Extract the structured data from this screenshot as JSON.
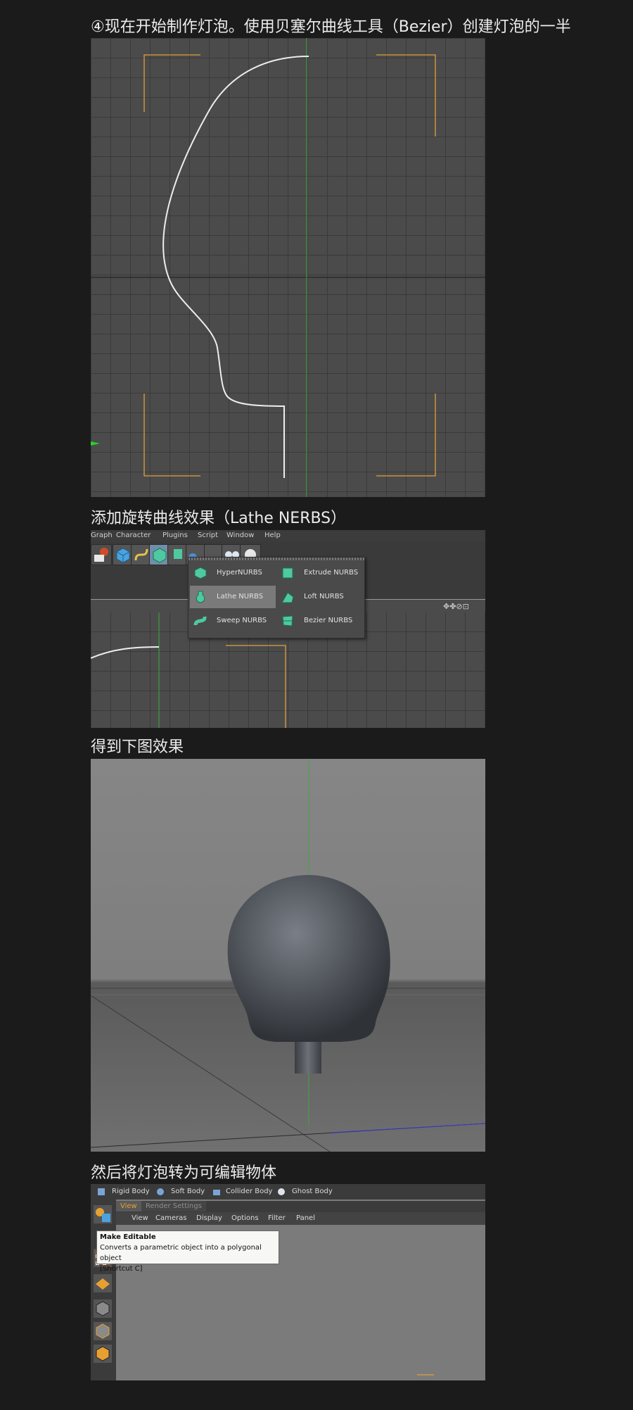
{
  "captions": {
    "step4": "④现在开始制作灯泡。使用贝塞尔曲线工具（Bezier）创建灯泡的一半",
    "lathe": "添加旋转曲线效果（Lathe NERBS）",
    "result": "得到下图效果",
    "editable": "然后将灯泡转为可编辑物体"
  },
  "menu": {
    "items": [
      "Graph",
      "Character",
      "Plugins",
      "Script",
      "Window",
      "Help"
    ]
  },
  "nurbs_menu": {
    "items": [
      {
        "label": "HyperNURBS",
        "icon": "hypernurbs-icon"
      },
      {
        "label": "Extrude NURBS",
        "icon": "extrude-nurbs-icon"
      },
      {
        "label": "Lathe NURBS",
        "icon": "lathe-nurbs-icon",
        "selected": true
      },
      {
        "label": "Loft NURBS",
        "icon": "loft-nurbs-icon"
      },
      {
        "label": "Sweep NURBS",
        "icon": "sweep-nurbs-icon"
      },
      {
        "label": "Bezier NURBS",
        "icon": "bezier-nurbs-icon"
      }
    ]
  },
  "dynamics_bar": {
    "items": [
      "Rigid Body",
      "Soft Body",
      "Collider Body",
      "Ghost Body"
    ]
  },
  "view_tabs": [
    "View",
    "Render Settings"
  ],
  "view_menu": [
    "View",
    "Cameras",
    "Display",
    "Options",
    "Filter",
    "Panel"
  ],
  "tooltip": {
    "title": "Make Editable",
    "description": "Converts a parametric object into a polygonal object",
    "shortcut": "[Shortcut C]"
  },
  "colors": {
    "accent_orange": "#e0a03a",
    "axis_green": "#3fa83f",
    "nurbs_green": "#4ec9a0",
    "background": "#1b1b1b"
  }
}
